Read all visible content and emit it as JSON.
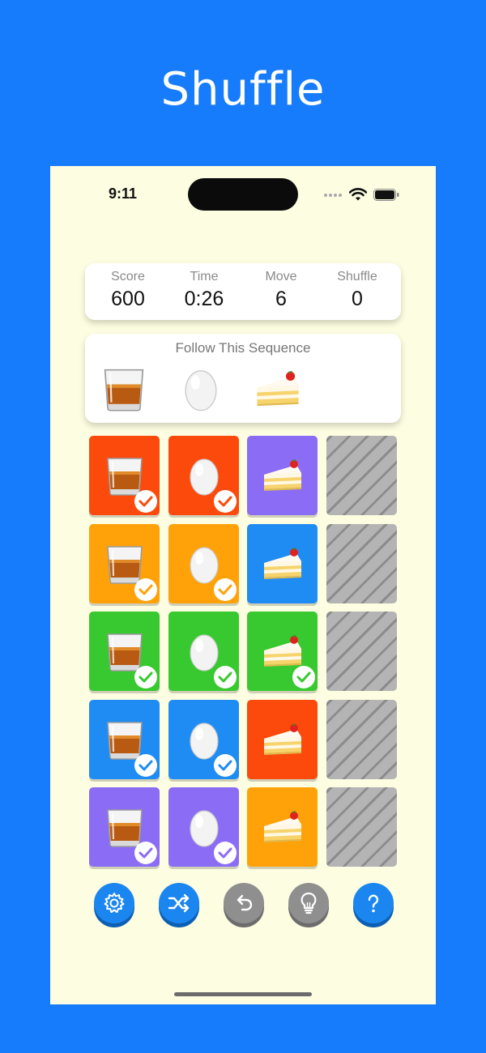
{
  "banner": {
    "title": "Shuffle"
  },
  "statusbar": {
    "time": "9:11"
  },
  "stats": [
    {
      "label": "Score",
      "value": "600"
    },
    {
      "label": "Time",
      "value": "0:26"
    },
    {
      "label": "Move",
      "value": "6"
    },
    {
      "label": "Shuffle",
      "value": "0"
    }
  ],
  "sequence": {
    "title": "Follow This Sequence",
    "items": [
      "whiskey-glass-icon",
      "egg-icon",
      "cake-slice-icon"
    ]
  },
  "grid": {
    "columns": 4,
    "rows": [
      [
        {
          "item": "whiskey-glass",
          "color": "#fc4a0c",
          "checked": true
        },
        {
          "item": "egg",
          "color": "#fc4a0c",
          "checked": true
        },
        {
          "item": "cake",
          "color": "#8b6cf5",
          "checked": false
        },
        {
          "item": "empty"
        }
      ],
      [
        {
          "item": "whiskey-glass",
          "color": "#ffa20a",
          "checked": true
        },
        {
          "item": "egg",
          "color": "#ffa20a",
          "checked": true
        },
        {
          "item": "cake",
          "color": "#1f8cf4",
          "checked": false
        },
        {
          "item": "empty"
        }
      ],
      [
        {
          "item": "whiskey-glass",
          "color": "#37c92f",
          "checked": true
        },
        {
          "item": "egg",
          "color": "#37c92f",
          "checked": true
        },
        {
          "item": "cake",
          "color": "#37c92f",
          "checked": true
        },
        {
          "item": "empty"
        }
      ],
      [
        {
          "item": "whiskey-glass",
          "color": "#1f8cf4",
          "checked": true
        },
        {
          "item": "egg",
          "color": "#1f8cf4",
          "checked": true
        },
        {
          "item": "cake",
          "color": "#fc4a0c",
          "checked": false
        },
        {
          "item": "empty"
        }
      ],
      [
        {
          "item": "whiskey-glass",
          "color": "#8b6cf5",
          "checked": true
        },
        {
          "item": "egg",
          "color": "#8b6cf5",
          "checked": true
        },
        {
          "item": "cake",
          "color": "#ffa20a",
          "checked": false
        },
        {
          "item": "empty"
        }
      ]
    ]
  },
  "toolbar": [
    {
      "name": "settings-button",
      "icon": "gear-icon",
      "style": "blue"
    },
    {
      "name": "shuffle-button",
      "icon": "shuffle-icon",
      "style": "blue"
    },
    {
      "name": "undo-button",
      "icon": "undo-icon",
      "style": "grey"
    },
    {
      "name": "hint-button",
      "icon": "lightbulb-icon",
      "style": "grey"
    },
    {
      "name": "help-button",
      "icon": "question-icon",
      "style": "blue"
    }
  ],
  "colors": {
    "background": "#167cfb",
    "panel": "#fdfde1",
    "accent": "#1b86f0"
  }
}
